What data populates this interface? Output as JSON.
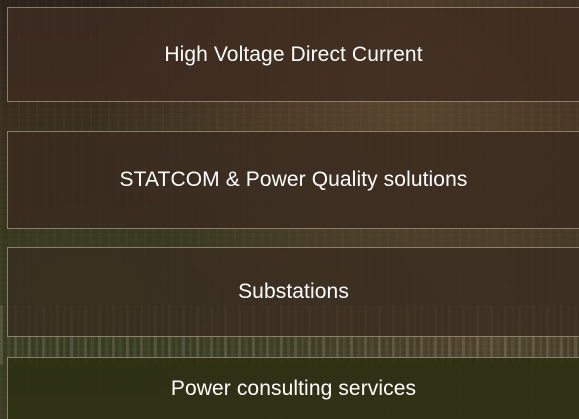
{
  "menu": {
    "items": [
      {
        "label": "High Voltage Direct Current"
      },
      {
        "label": "STATCOM & Power Quality solutions"
      },
      {
        "label": "Substations"
      },
      {
        "label": "Power consulting services"
      }
    ]
  }
}
